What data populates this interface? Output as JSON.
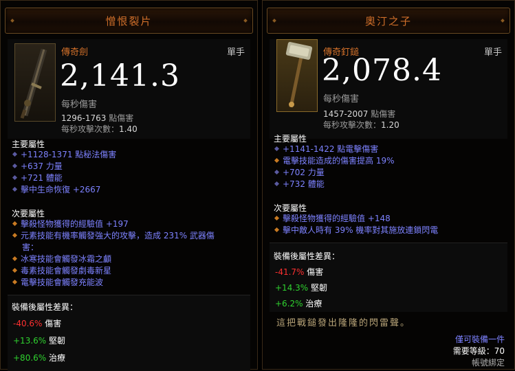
{
  "left": {
    "name": "憎恨裂片",
    "type": "傳奇劍",
    "slot": "單手",
    "dps": "2,141.3",
    "dps_label": "每秒傷害",
    "damage_range": "1296-1763",
    "damage_label": "點傷害",
    "attacks_label": "每秒攻擊次數：",
    "attacks_value": "1.40",
    "primary_title": "主要屬性",
    "primary": [
      "+1128-1371 點秘法傷害",
      "+637 力量",
      "+721 體能",
      "擊中生命恢復 +2667"
    ],
    "secondary_title": "次要屬性",
    "secondary": [
      "擊殺怪物獲得的經驗值 +197",
      "元素技能有機率觸發強大的攻擊，造成 231% 武器傷",
      "害：",
      "冰寒技能會觸發冰霜之顱",
      "毒素技能會觸發劇毒新星",
      "電擊技能會觸發充能波"
    ],
    "diff_title": "裝備後屬性差異：",
    "diffs": [
      {
        "value": "-40.6%",
        "label": "傷害",
        "tone": "red"
      },
      {
        "value": "+13.6%",
        "label": "堅韌",
        "tone": "green"
      },
      {
        "value": "+80.6%",
        "label": "治療",
        "tone": "green"
      }
    ]
  },
  "right": {
    "name": "奧汀之子",
    "type": "傳奇釘鎚",
    "slot": "單手",
    "dps": "2,078.4",
    "dps_label": "每秒傷害",
    "damage_range": "1457-2007",
    "damage_label": "點傷害",
    "attacks_label": "每秒攻擊次數：",
    "attacks_value": "1.20",
    "primary_title": "主要屬性",
    "primary": [
      "+1141-1422 點電擊傷害",
      "電擊技能造成的傷害提高 19%",
      "+702 力量",
      "+732 體能"
    ],
    "secondary_title": "次要屬性",
    "secondary": [
      "擊殺怪物獲得的經驗值 +148",
      "擊中敵人時有 39% 機率對其施放連鎖閃電"
    ],
    "diff_title": "裝備後屬性差異：",
    "diffs": [
      {
        "value": "-41.7%",
        "label": "傷害",
        "tone": "red"
      },
      {
        "value": "+14.3%",
        "label": "堅韌",
        "tone": "green"
      },
      {
        "value": "+6.2%",
        "label": "治療",
        "tone": "green"
      }
    ],
    "flavor": "這把戰鎚發出隆隆的閃雷聲。",
    "class_restriction": "僅可裝備一件",
    "level_req": "需要等級：70",
    "account_bound": "帳號綁定"
  },
  "colors": {
    "legendary": "#d2702a",
    "magic": "#7d82ff",
    "negative": "#ff3030",
    "positive": "#2fd22f"
  }
}
